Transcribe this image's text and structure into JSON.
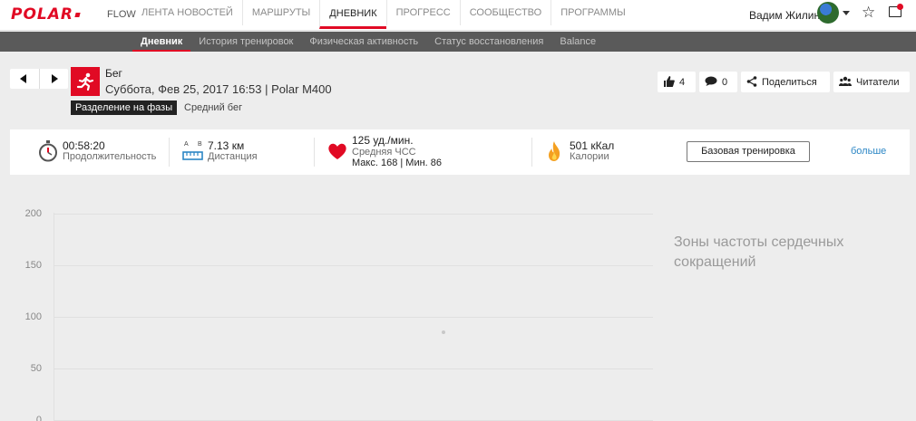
{
  "topnav": {
    "logo_text": "POLAR",
    "flow": "FLOW",
    "items": [
      {
        "label": "ЛЕНТА НОВОСТЕЙ"
      },
      {
        "label": "МАРШРУТЫ"
      },
      {
        "label": "ДНЕВНИК"
      },
      {
        "label": "ПРОГРЕСС"
      },
      {
        "label": "СООБЩЕСТВО"
      },
      {
        "label": "ПРОГРАММЫ"
      }
    ],
    "active": "ДНЕВНИК",
    "user_name": "Вадим Жилин"
  },
  "subnav": {
    "items": [
      {
        "label": "Дневник"
      },
      {
        "label": "История тренировок"
      },
      {
        "label": "Физическая активность"
      },
      {
        "label": "Статус восстановления"
      },
      {
        "label": "Balance"
      }
    ],
    "active": "Дневник"
  },
  "session": {
    "sport": "Бег",
    "date_line": "Суббота, Фев 25, 2017 16:53 | Polar M400",
    "phase_badge": "Разделение на фазы",
    "phase_name": "Средний бег",
    "likes": "4",
    "comments": "0",
    "share_label": "Поделиться",
    "readers_label": "Читатели"
  },
  "summary": {
    "duration_value": "00:58:20",
    "duration_label": "Продолжительность",
    "distance_icon_a": "A",
    "distance_icon_b": "B",
    "distance_value": "7.13 км",
    "distance_label": "Дистанция",
    "hr_value": "125 уд./мин.",
    "hr_label": "Средняя ЧСС",
    "hr_minmax": "Макс. 168  |  Мин. 86",
    "calories_value": "501 кКал",
    "calories_label": "Калории",
    "base_training_label": "Базовая тренировка",
    "more_label": "больше"
  },
  "zones": {
    "title": "Зоны частоты сердечных сокращений"
  },
  "chart_data": {
    "type": "scatter",
    "yticks": [
      "200",
      "150",
      "100",
      "50",
      "0"
    ],
    "ylim": [
      0,
      200
    ],
    "grid": true,
    "series": []
  },
  "colors": {
    "brand_red": "#e10a24",
    "link_blue": "#2b86c5",
    "subnav_bg": "#5a5a5a"
  },
  "icons": {
    "sport": "running-person-icon",
    "duration": "stopwatch-icon",
    "distance": "ruler-icon",
    "hr": "heart-icon",
    "calories": "flame-icon"
  }
}
